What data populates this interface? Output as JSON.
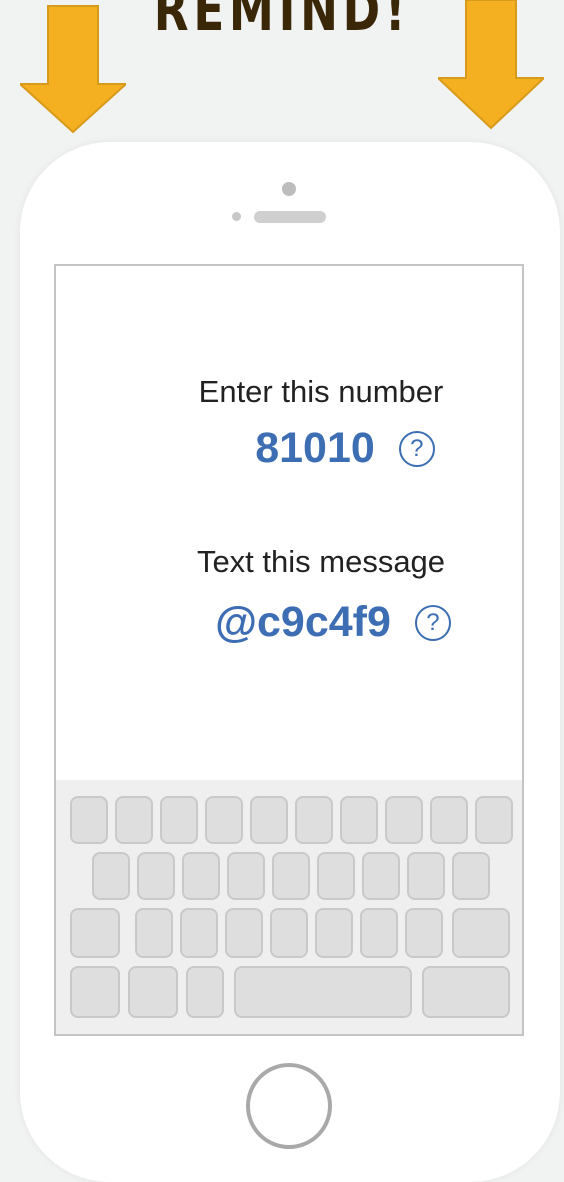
{
  "banner": {
    "text": "REMIND!"
  },
  "instructions": {
    "number_prompt": "Enter this number",
    "number_value": "81010",
    "message_prompt": "Text this message",
    "message_value": "@c9c4f9",
    "help_glyph": "?"
  },
  "colors": {
    "accent_blue": "#3d6eb4",
    "arrow_orange": "#f5b021",
    "banner_text": "#3a2708"
  },
  "icons": [
    "arrow-down-icon",
    "help-icon",
    "home-button-icon"
  ]
}
